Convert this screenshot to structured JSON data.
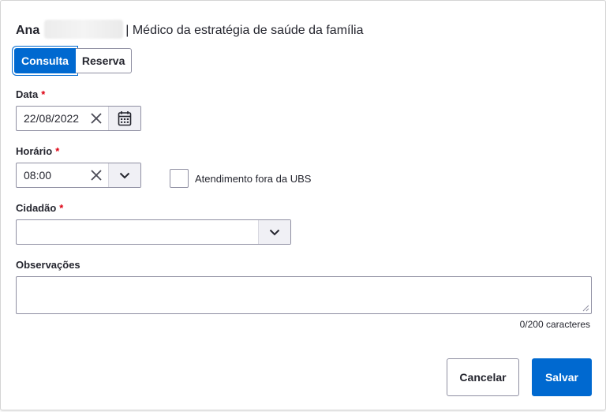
{
  "header": {
    "first_name": "Ana",
    "separator": "|",
    "role": "Médico da estratégia de saúde da família"
  },
  "tabs": [
    {
      "label": "Consulta",
      "active": true
    },
    {
      "label": "Reserva",
      "active": false
    }
  ],
  "form": {
    "date": {
      "label": "Data",
      "required_mark": "*",
      "value": "22/08/2022"
    },
    "time": {
      "label": "Horário",
      "required_mark": "*",
      "value": "08:00"
    },
    "outside_ubs": {
      "label": "Atendimento fora da UBS",
      "checked": false
    },
    "citizen": {
      "label": "Cidadão",
      "required_mark": "*",
      "value": ""
    },
    "notes": {
      "label": "Observações",
      "value": "",
      "counter": "0/200 caracteres"
    }
  },
  "actions": {
    "cancel_label": "Cancelar",
    "save_label": "Salvar"
  },
  "colors": {
    "primary": "#0069d0",
    "required": "#dd0011",
    "border": "#8f8fa2"
  },
  "icons": [
    "close-icon",
    "calendar-icon",
    "chevron-down-icon",
    "resize-grip-icon"
  ]
}
